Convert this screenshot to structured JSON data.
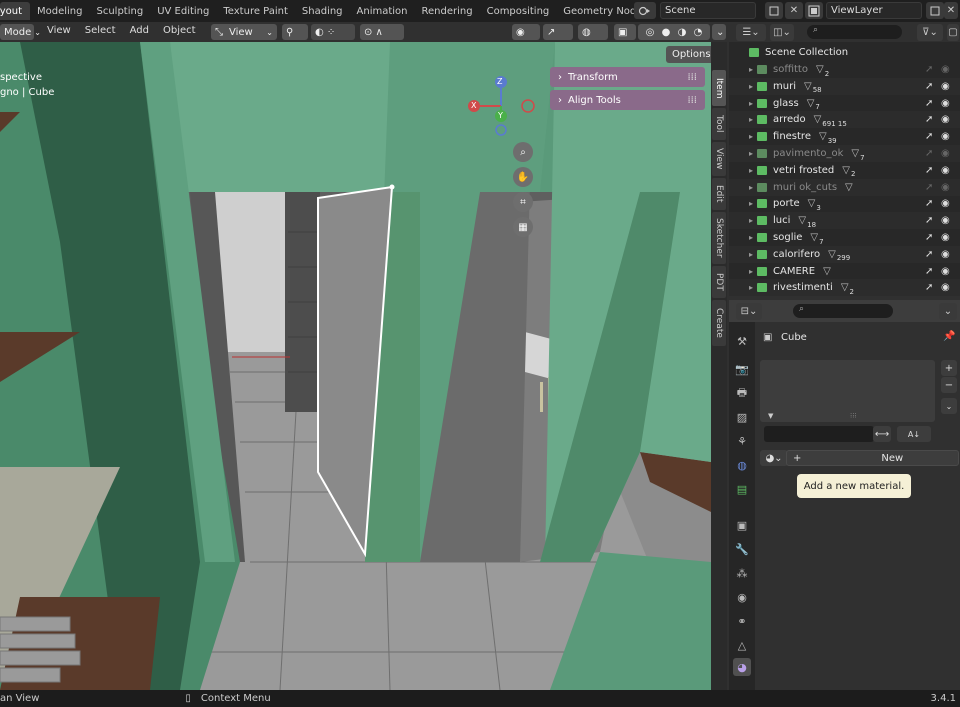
{
  "workspaces": [
    "Layout",
    "Modeling",
    "Sculpting",
    "UV Editing",
    "Texture Paint",
    "Shading",
    "Animation",
    "Rendering",
    "Compositing",
    "Geometry Nodes"
  ],
  "scene": "Scene",
  "view_layer": "ViewLayer",
  "viewport_header": {
    "mode": "Mode",
    "menus": [
      "View",
      "Select",
      "Add",
      "Object"
    ],
    "orientation": "View",
    "options_label": "Options"
  },
  "viewport_overlay": {
    "line1": "spective",
    "line2": "gno | Cube"
  },
  "gizmo": {
    "x": "X",
    "y": "Y",
    "z": "Z"
  },
  "npanel": {
    "transform": "Transform",
    "align_tools": "Align Tools",
    "tabs": [
      "Item",
      "Tool",
      "View",
      "Edit",
      "Sketcher",
      "PDT",
      "Create"
    ]
  },
  "outliner": {
    "root": "Scene Collection",
    "items": [
      {
        "name": "soffitto",
        "count": "2",
        "dim": true
      },
      {
        "name": "muri",
        "count": "58",
        "dim": false
      },
      {
        "name": "glass",
        "count": "7",
        "dim": false
      },
      {
        "name": "arredo",
        "count": "691 15",
        "dim": false
      },
      {
        "name": "finestre",
        "count": "39",
        "dim": false
      },
      {
        "name": "pavimento_ok",
        "count": "7",
        "dim": true
      },
      {
        "name": "vetri frosted",
        "count": "2",
        "dim": false
      },
      {
        "name": "muri ok_cuts",
        "count": "",
        "dim": true
      },
      {
        "name": "porte",
        "count": "3",
        "dim": false
      },
      {
        "name": "luci",
        "count": "18",
        "dim": false
      },
      {
        "name": "soglie",
        "count": "7",
        "dim": false
      },
      {
        "name": "calorifero",
        "count": "299",
        "dim": false
      },
      {
        "name": "CAMERE",
        "count": "",
        "dim": false
      },
      {
        "name": "rivestimenti",
        "count": "2",
        "dim": false
      }
    ]
  },
  "properties": {
    "object_name": "Cube",
    "new_button": "New",
    "tooltip": "Add a new material."
  },
  "status": {
    "left": "an View",
    "context_menu": "Context Menu",
    "version": "3.4.1"
  }
}
